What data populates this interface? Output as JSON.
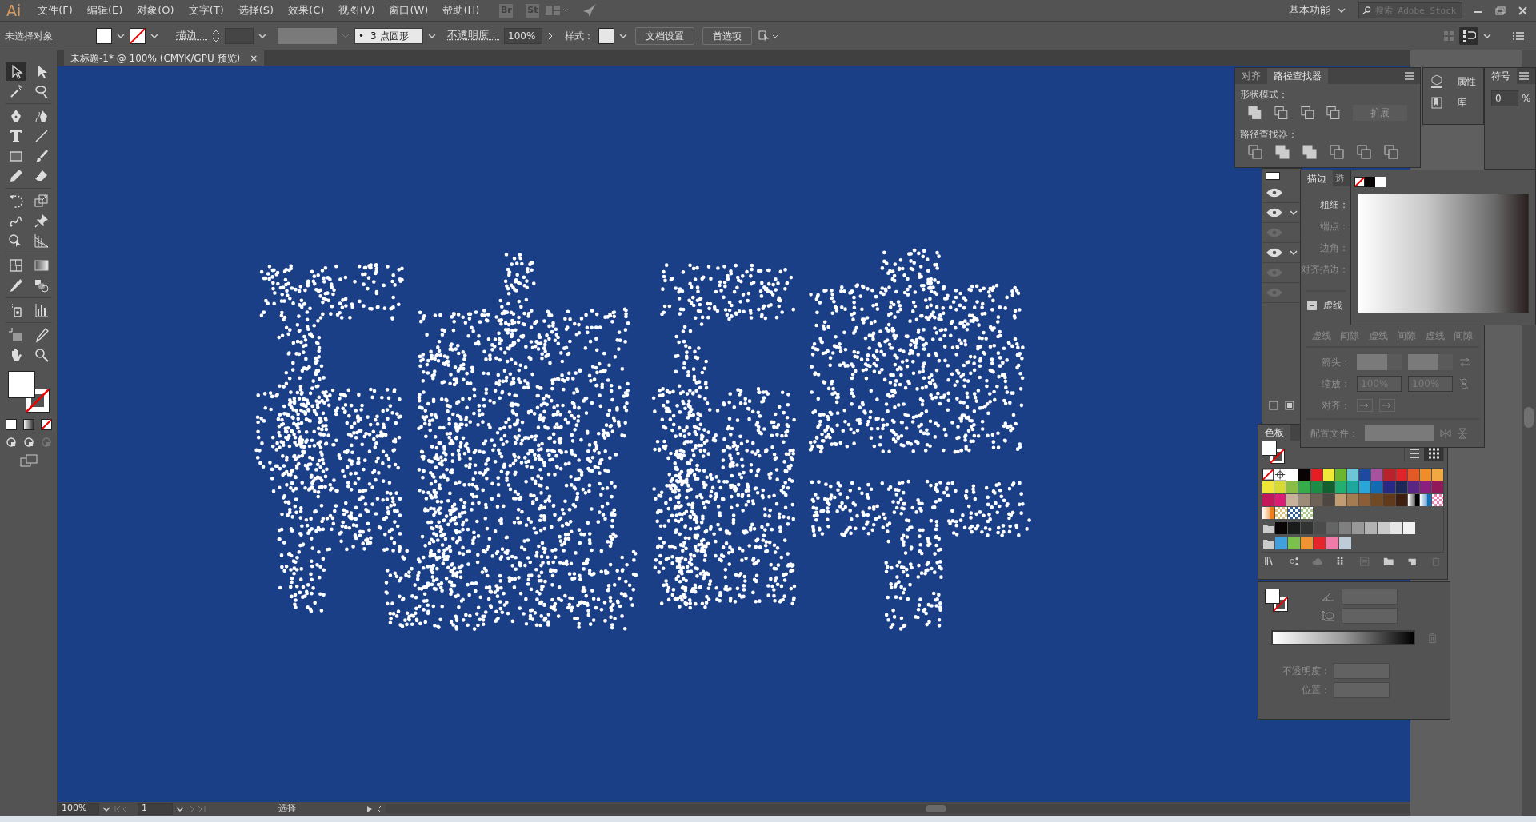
{
  "app_logo": "Ai",
  "menu": [
    "文件(F)",
    "编辑(E)",
    "对象(O)",
    "文字(T)",
    "选择(S)",
    "效果(C)",
    "视图(V)",
    "窗口(W)",
    "帮助(H)"
  ],
  "app_badges": [
    "Br",
    "St"
  ],
  "workspace": "基本功能",
  "stock_search": {
    "placeholder": "搜索 Adobe Stock"
  },
  "control_bar": {
    "selection": "未选择对象",
    "stroke_label": "描边：",
    "brush_dot": "•",
    "brush": "3 点圆形",
    "opacity_label": "不透明度：",
    "opacity": "100%",
    "style_label": "样式：",
    "buttons": [
      "文档设置",
      "首选项"
    ]
  },
  "document_tab": {
    "title": "未标题-1* @ 100% (CMYK/GPU 预览)",
    "close": "×"
  },
  "toolbar": {
    "tools": [
      {
        "selected": true
      },
      {
        "selected": false
      },
      {
        "selected": false
      },
      {
        "selected": false
      },
      {
        "selected": false
      },
      {
        "selected": false
      },
      {
        "selected": false
      },
      {
        "selected": false
      },
      {
        "selected": false
      },
      {
        "selected": false
      },
      {
        "selected": false
      },
      {
        "selected": false
      },
      {
        "selected": false
      },
      {
        "selected": false
      },
      {
        "selected": false
      },
      {
        "selected": false
      },
      {
        "selected": false
      },
      {
        "selected": false
      },
      {
        "selected": false
      },
      {
        "selected": false
      },
      {
        "selected": false
      },
      {
        "selected": false
      },
      {
        "selected": false
      },
      {
        "selected": false
      },
      {
        "selected": false
      },
      {
        "selected": false
      },
      {
        "selected": false
      },
      {
        "selected": false
      }
    ]
  },
  "pathfinder_panel": {
    "tabs": [
      {
        "label": "对齐",
        "selected": false
      },
      {
        "label": "路径查找器",
        "selected": true
      }
    ],
    "shape_modes_label": "形状模式：",
    "expand_button": "扩展",
    "pathfinders_label": "路径查找器："
  },
  "mini_panel": {
    "items": [
      "属性",
      "库"
    ]
  },
  "symbols_panel": {
    "tab": "符号",
    "value": "0",
    "unit": "%"
  },
  "layers": {
    "rows": [
      {
        "visible": true,
        "toggle": false
      },
      {
        "visible": true,
        "toggle": true
      },
      {
        "visible": false,
        "toggle": false
      },
      {
        "visible": true,
        "toggle": true
      },
      {
        "visible": false,
        "toggle": false
      },
      {
        "visible": false,
        "toggle": false
      }
    ]
  },
  "stroke_panel": {
    "tabs": [
      {
        "label": "描边",
        "selected": true
      },
      {
        "label": "透",
        "selected": false
      }
    ],
    "rows": [
      {
        "label": "粗细：",
        "disabled": false
      },
      {
        "label": "端点：",
        "disabled": true
      },
      {
        "label": "边角：",
        "disabled": true
      },
      {
        "label": "对齐描边：",
        "disabled": true
      }
    ],
    "dashed": {
      "label": "虚线",
      "expanded": true
    },
    "dash_labels": [
      "虚线",
      "间隙",
      "虚线",
      "间隙",
      "虚线",
      "间隙"
    ],
    "arrowheads_label": "箭头：",
    "scale_label": "缩放：",
    "scale_values": [
      "100%",
      "100%"
    ],
    "align_label": "对齐：",
    "profile_label": "配置文件："
  },
  "swatches_panel": {
    "title": "色板",
    "swatches": [
      {
        "kind": "none"
      },
      {
        "kind": "registration"
      },
      {
        "kind": "color",
        "color": "#ffffff"
      },
      {
        "kind": "color",
        "color": "#0a0303"
      },
      {
        "kind": "color",
        "color": "#e61d23"
      },
      {
        "kind": "color",
        "color": "#eeea37"
      },
      {
        "kind": "color",
        "color": "#6cb52f"
      },
      {
        "kind": "color",
        "color": "#6dc6d6"
      },
      {
        "kind": "color",
        "color": "#1b4aa0"
      },
      {
        "kind": "color",
        "color": "#a6529c"
      },
      {
        "kind": "color",
        "color": "#b9222a"
      },
      {
        "kind": "color",
        "color": "#e0222b"
      },
      {
        "kind": "color",
        "color": "#e45a27"
      },
      {
        "kind": "color",
        "color": "#ef8d28"
      },
      {
        "kind": "color",
        "color": "#f1a842"
      },
      {
        "kind": "color",
        "color": "#f0e638"
      },
      {
        "kind": "color",
        "color": "#d6d932"
      },
      {
        "kind": "color",
        "color": "#89bd45"
      },
      {
        "kind": "color",
        "color": "#37ab4a"
      },
      {
        "kind": "color",
        "color": "#1d8c45"
      },
      {
        "kind": "color",
        "color": "#12602f"
      },
      {
        "kind": "color",
        "color": "#22b071"
      },
      {
        "kind": "color",
        "color": "#1ea79d"
      },
      {
        "kind": "color",
        "color": "#2aa4d9"
      },
      {
        "kind": "color",
        "color": "#136bb1"
      },
      {
        "kind": "color",
        "color": "#282a82"
      },
      {
        "kind": "color",
        "color": "#1c2858"
      },
      {
        "kind": "color",
        "color": "#5b2583"
      },
      {
        "kind": "color",
        "color": "#8b1e7e"
      },
      {
        "kind": "color",
        "color": "#8f1a57"
      },
      {
        "kind": "color",
        "color": "#c3185b"
      },
      {
        "kind": "color",
        "color": "#db1c73"
      },
      {
        "kind": "color",
        "color": "#c8b39a"
      },
      {
        "kind": "color",
        "color": "#9b8b77"
      },
      {
        "kind": "color",
        "color": "#6f6153"
      },
      {
        "kind": "color",
        "color": "#4f4641"
      },
      {
        "kind": "color",
        "color": "#c39d72"
      },
      {
        "kind": "color",
        "color": "#a57c52"
      },
      {
        "kind": "color",
        "color": "#8b5e38"
      },
      {
        "kind": "color",
        "color": "#704a24"
      },
      {
        "kind": "color",
        "color": "#61391b"
      },
      {
        "kind": "color",
        "color": "#3f2010"
      },
      {
        "kind": "gradient",
        "color": "#000000"
      },
      {
        "kind": "gradient",
        "color": "#1570b8"
      },
      {
        "kind": "pattern",
        "color": "#ee7fb0"
      },
      {
        "kind": "gradient",
        "color": "#ee7f1a"
      },
      {
        "kind": "pattern",
        "color": "#d9c27a"
      },
      {
        "kind": "pattern",
        "color": "#2c5d9c"
      },
      {
        "kind": "pattern",
        "color": "#a8c98a"
      }
    ],
    "groups": [
      {
        "swatches": [
          {
            "color": "#0a0505"
          },
          {
            "color": "#1a1b1b"
          },
          {
            "color": "#323333"
          },
          {
            "color": "#4b4b4b"
          },
          {
            "color": "#646565"
          },
          {
            "color": "#7f7f7f"
          },
          {
            "color": "#989898"
          },
          {
            "color": "#b2b2b2"
          },
          {
            "color": "#cbcbcb"
          },
          {
            "color": "#e5e5e5"
          },
          {
            "color": "#f2f2f2"
          }
        ]
      },
      {
        "swatches": [
          {
            "color": "#429fdb"
          },
          {
            "color": "#7ac04a"
          },
          {
            "color": "#f29331"
          },
          {
            "color": "#e5242c"
          },
          {
            "color": "#ef7ba8"
          },
          {
            "color": "#bdccd6"
          }
        ]
      }
    ]
  },
  "gradient_panel": {
    "opacity_label": "不透明度：",
    "location_label": "位置："
  },
  "status_bar": {
    "zoom": "100%",
    "artboard": "1",
    "tool": "选择"
  }
}
